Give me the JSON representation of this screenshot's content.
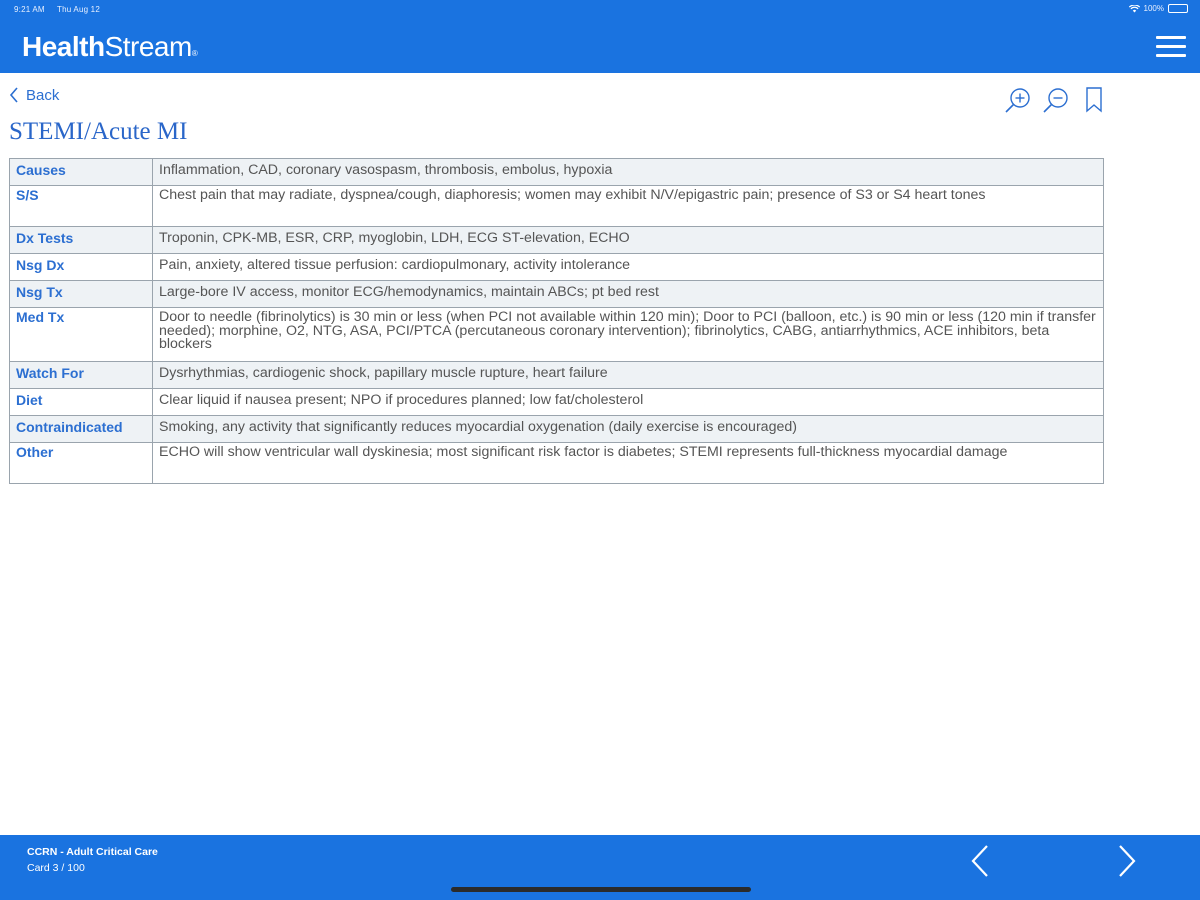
{
  "status": {
    "time": "9:21 AM",
    "date": "Thu Aug 12",
    "battery": "100%"
  },
  "app": {
    "logo_bold": "Health",
    "logo_light": "Stream",
    "logo_mark": "®"
  },
  "nav": {
    "back_label": "Back"
  },
  "card": {
    "title": "STEMI/Acute MI",
    "rows": [
      {
        "label": "Causes",
        "value": "Inflammation, CAD, coronary vasospasm, thrombosis, embolus, hypoxia"
      },
      {
        "label": "S/S",
        "value": "Chest pain that may radiate, dyspnea/cough, diaphoresis; women may exhibit N/V/epigastric pain; presence of S3 or S4 heart tones"
      },
      {
        "label": "Dx Tests",
        "value": "Troponin, CPK-MB, ESR, CRP, myoglobin, LDH, ECG ST-elevation, ECHO"
      },
      {
        "label": "Nsg Dx",
        "value": "Pain, anxiety, altered tissue perfusion: cardiopulmonary, activity intolerance"
      },
      {
        "label": "Nsg Tx",
        "value": "Large-bore IV access, monitor ECG/hemodynamics, maintain ABCs; pt bed rest"
      },
      {
        "label": "Med Tx",
        "value": "Door to needle (fibrinolytics) is 30 min or less (when PCI not available within 120 min); Door to PCI (balloon, etc.) is 90 min or less (120 min if transfer needed); morphine, O2, NTG, ASA, PCI/PTCA (percutaneous coronary intervention); fibrinolytics, CABG, antiarrhythmics, ACE inhibitors, beta blockers"
      },
      {
        "label": "Watch For",
        "value": "Dysrhythmias, cardiogenic shock, papillary muscle rupture, heart failure"
      },
      {
        "label": "Diet",
        "value": "Clear liquid if nausea present; NPO if procedures planned; low fat/cholesterol"
      },
      {
        "label": "Contraindicated",
        "value": "Smoking, any activity that significantly reduces myocardial oxygenation (daily exercise is encouraged)"
      },
      {
        "label": "Other",
        "value": "ECHO will show ventricular wall dyskinesia; most significant risk factor is diabetes; STEMI represents full-thickness myocardial damage"
      }
    ]
  },
  "footer": {
    "deck_title": "CCRN - Adult Critical Care",
    "card_count": "Card 3 / 100"
  },
  "icons": {
    "zoom_in": "zoom-in-icon",
    "zoom_out": "zoom-out-icon",
    "bookmark": "bookmark-icon",
    "menu": "hamburger-menu-icon",
    "prev": "chevron-left-icon",
    "next": "chevron-right-icon"
  },
  "colors": {
    "brand": "#1a73e0",
    "link": "#2c6fd1",
    "title": "#2a66c9",
    "row_alt": "#eef2f5"
  }
}
